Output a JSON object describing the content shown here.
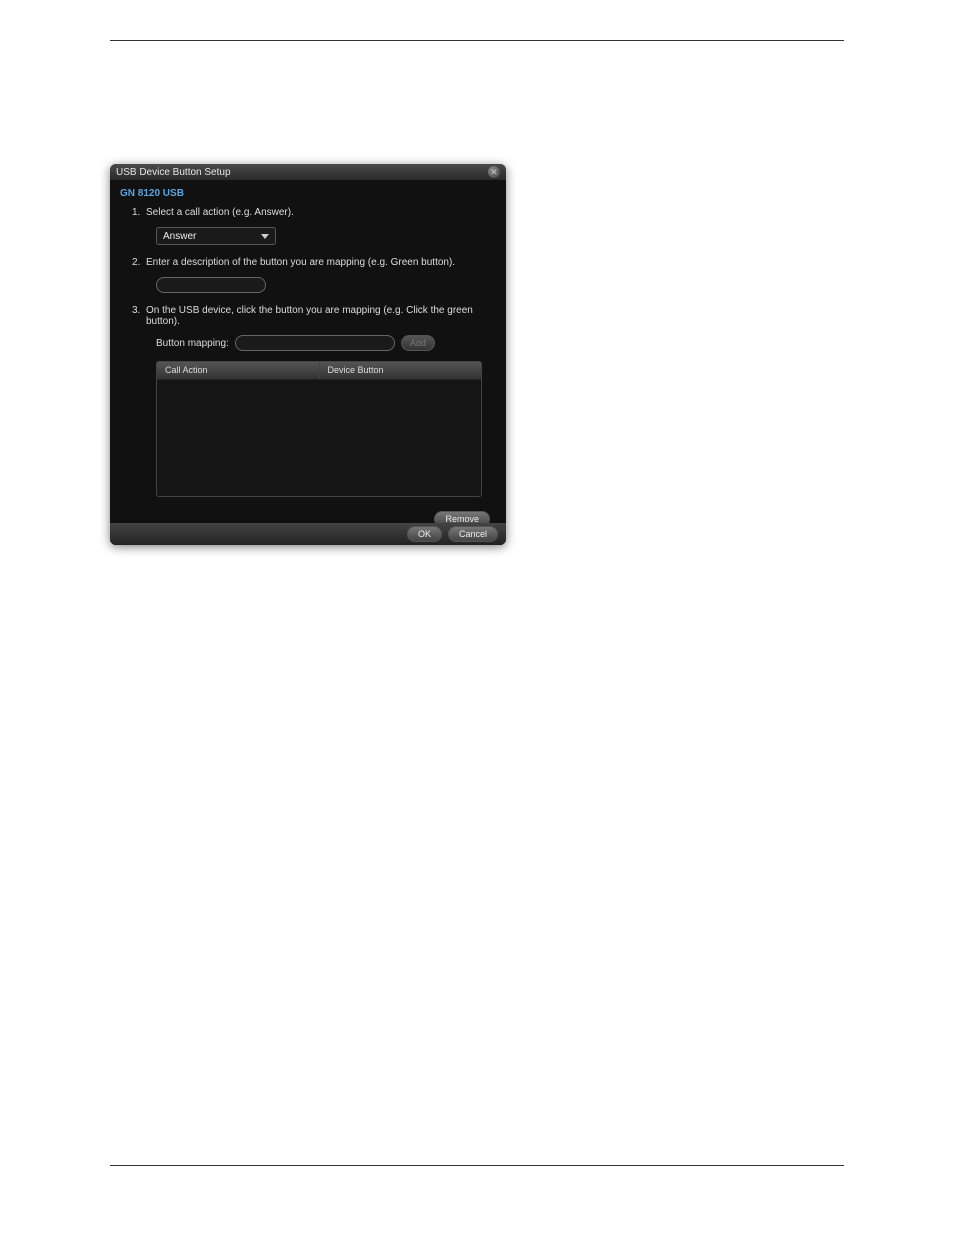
{
  "dialog": {
    "title": "USB Device Button Setup",
    "subtitle": "GN 8120 USB",
    "steps": {
      "s1": {
        "num": "1.",
        "text": "Select a call action (e.g. Answer)."
      },
      "s2": {
        "num": "2.",
        "text": "Enter a description of the button you are mapping (e.g. Green button)."
      },
      "s3": {
        "num": "3.",
        "text": "On the USB device, click the button you are mapping (e.g. Click the green button)."
      }
    },
    "dropdown": {
      "selected": "Answer"
    },
    "mapping_label": "Button mapping:",
    "add_label": "Add",
    "table": {
      "col1": "Call Action",
      "col2": "Device Button"
    },
    "remove_label": "Remove",
    "ok_label": "OK",
    "cancel_label": "Cancel"
  }
}
